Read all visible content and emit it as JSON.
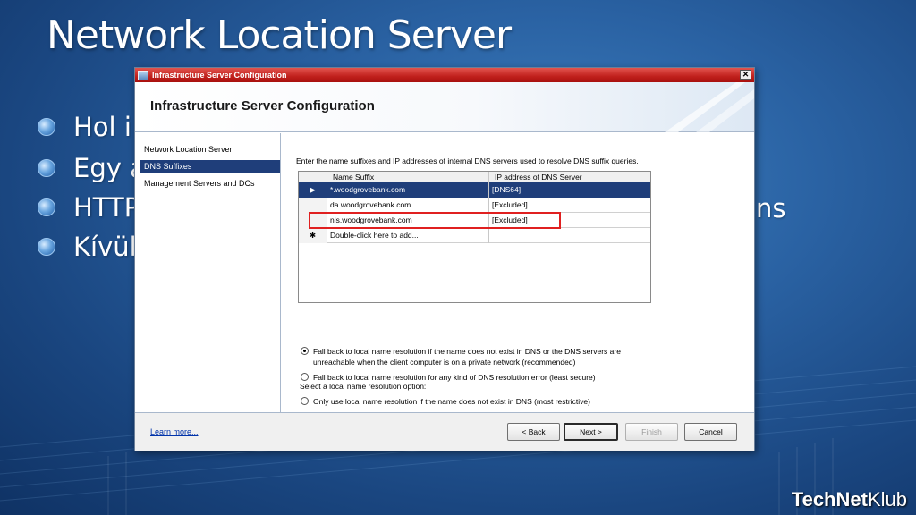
{
  "slide": {
    "title": "Network Location Server",
    "bullets": [
      "Hol i",
      "Egy a",
      "HTTP",
      "Kívül"
    ],
    "bullet_tail": "ns",
    "brand_bold": "TechNet",
    "brand_regular": "Klub"
  },
  "dialog": {
    "window_title": "Infrastructure Server Configuration",
    "close_glyph": "✕",
    "header_title": "Infrastructure Server Configuration",
    "nav": [
      {
        "label": "Network Location Server"
      },
      {
        "label": "DNS Suffixes"
      },
      {
        "label": "Management Servers and DCs"
      }
    ],
    "selected_nav": "DNS Suffixes",
    "intro": "Enter the name suffixes and IP addresses of internal DNS servers used to resolve DNS suffix queries.",
    "grid": {
      "columns": [
        "Name Suffix",
        "IP address of DNS Server"
      ],
      "rows": [
        {
          "marker": "▶",
          "suffix": "*.woodgrovebank.com",
          "ip": "[DNS64]"
        },
        {
          "marker": "",
          "suffix": "da.woodgrovebank.com",
          "ip": "[Excluded]"
        },
        {
          "marker": "",
          "suffix": "nls.woodgrovebank.com",
          "ip": "[Excluded]"
        },
        {
          "marker": "✱",
          "suffix": "Double-click here to add...",
          "ip": ""
        }
      ]
    },
    "resolution": {
      "label": "Select a local name resolution option:",
      "options": [
        {
          "text": "Only use local name resolution if the name does not exist in DNS (most restrictive)",
          "selected": false
        },
        {
          "text": "Fall back to local name resolution if the name does not exist in DNS or the DNS servers are unreachable when the client computer is on a private network (recommended)",
          "selected": true
        },
        {
          "text": "Fall back to local name resolution for any kind of DNS resolution error (least secure)",
          "selected": false
        }
      ]
    },
    "footer": {
      "learn_more": "Learn more...",
      "back": "< Back",
      "next": "Next >",
      "finish": "Finish",
      "cancel": "Cancel"
    }
  }
}
